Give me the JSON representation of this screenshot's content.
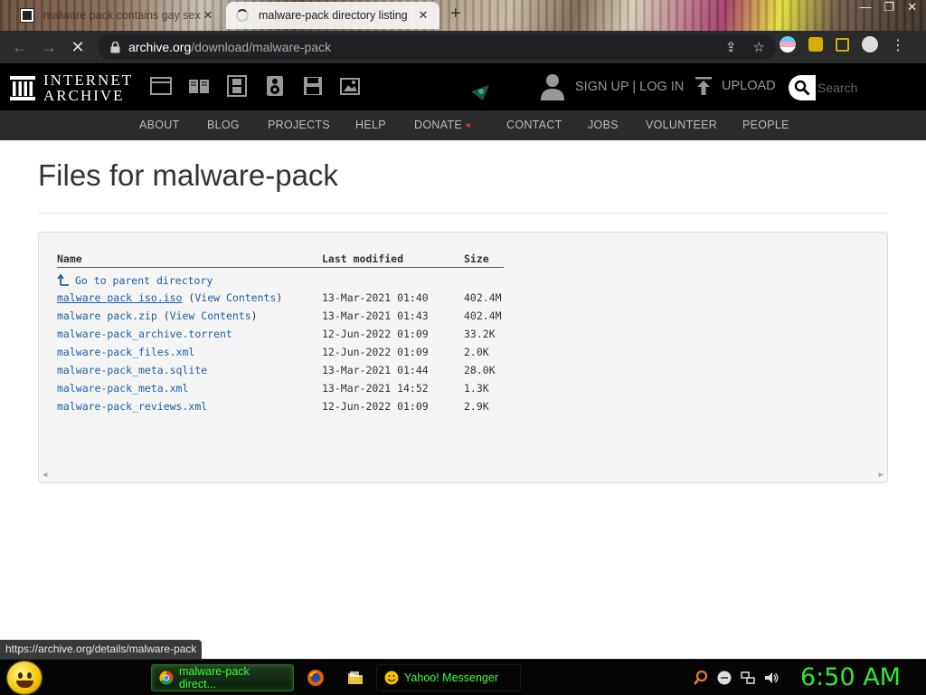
{
  "browser": {
    "tabs": [
      {
        "title": "malware pack contains gay sex",
        "active": false
      },
      {
        "title": "malware-pack directory listing",
        "active": true
      }
    ],
    "url_host": "archive.org",
    "url_path": "/download/malware-pack"
  },
  "ia_header": {
    "logo_line1": "INTERNET",
    "logo_line2": "ARCHIVE",
    "signup_label": "SIGN UP | LOG IN",
    "upload_label": "UPLOAD",
    "search_placeholder": "Search",
    "nav": [
      "ABOUT",
      "BLOG",
      "PROJECTS",
      "HELP",
      "DONATE",
      "CONTACT",
      "JOBS",
      "VOLUNTEER",
      "PEOPLE"
    ]
  },
  "page": {
    "title": "Files for malware-pack"
  },
  "listing": {
    "columns": [
      "Name",
      "Last modified",
      "Size"
    ],
    "parent_label": "Go to parent directory",
    "view_contents_label": "View Contents",
    "files": [
      {
        "name": "malware pack iso.iso",
        "view_contents": true,
        "modified": "13-Mar-2021 01:40",
        "size": "402.4M"
      },
      {
        "name": "malware pack.zip",
        "view_contents": true,
        "modified": "13-Mar-2021 01:43",
        "size": "402.4M"
      },
      {
        "name": "malware-pack_archive.torrent",
        "view_contents": false,
        "modified": "12-Jun-2022 01:09",
        "size": "33.2K"
      },
      {
        "name": "malware-pack_files.xml",
        "view_contents": false,
        "modified": "12-Jun-2022 01:09",
        "size": "2.0K"
      },
      {
        "name": "malware-pack_meta.sqlite",
        "view_contents": false,
        "modified": "13-Mar-2021 01:44",
        "size": "28.0K"
      },
      {
        "name": "malware-pack_meta.xml",
        "view_contents": false,
        "modified": "13-Mar-2021 14:52",
        "size": "1.3K"
      },
      {
        "name": "malware-pack_reviews.xml",
        "view_contents": false,
        "modified": "12-Jun-2022 01:09",
        "size": "2.9K"
      }
    ]
  },
  "status_bar": {
    "hover_url": "https://archive.org/details/malware-pack"
  },
  "taskbar": {
    "tasks": [
      {
        "label": "malware-pack direct...",
        "icon": "chrome-icon",
        "active": true
      },
      {
        "label": "Yahoo! Messenger",
        "icon": "yahoo-messenger-icon",
        "active": false
      }
    ],
    "clock": "6:50 AM"
  },
  "colors": {
    "link": "#1b5ea7",
    "ia_header_bg": "#000000",
    "ia_nav_bg": "#2b2b2b",
    "taskbar_text": "#3cff3c",
    "clock": "#2ee82e"
  }
}
